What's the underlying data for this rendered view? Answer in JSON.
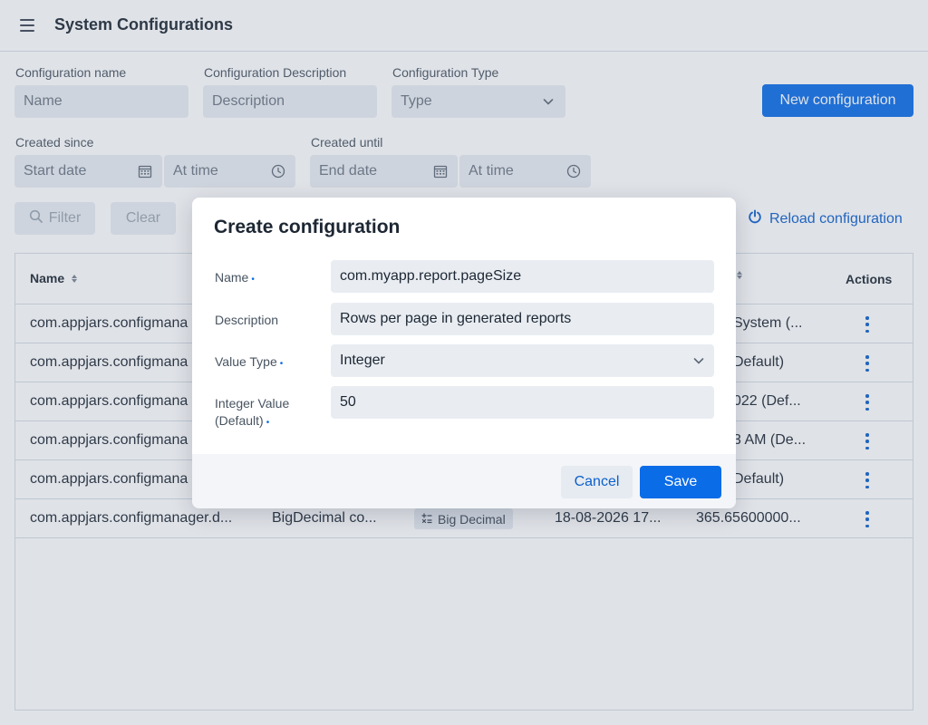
{
  "header": {
    "title": "System Configurations",
    "menu_icon": "hamburger-icon"
  },
  "filters": {
    "name": {
      "label": "Configuration name",
      "placeholder": "Name"
    },
    "description": {
      "label": "Configuration Description",
      "placeholder": "Description"
    },
    "type": {
      "label": "Configuration Type",
      "placeholder": "Type"
    },
    "created_since": {
      "label": "Created since",
      "date_placeholder": "Start date",
      "time_placeholder": "At time"
    },
    "created_until": {
      "label": "Created until",
      "date_placeholder": "End date",
      "time_placeholder": "At time"
    },
    "filter_button": "Filter",
    "clear_button": "Clear"
  },
  "toolbar": {
    "new_configuration": "New configuration",
    "reload_configuration": "Reload configuration"
  },
  "table": {
    "columns": {
      "name": "Name",
      "actions": "Actions"
    },
    "rows": [
      {
        "name": "com.appjars.configmana",
        "value": "System (..."
      },
      {
        "name": "com.appjars.configmana",
        "value": "Default)"
      },
      {
        "name": "com.appjars.configmana",
        "value": "022 (Def..."
      },
      {
        "name": "com.appjars.configmana",
        "value": "3 AM (De..."
      },
      {
        "name": "com.appjars.configmana",
        "value": "Default)"
      },
      {
        "name": "com.appjars.configmanager.d...",
        "description": "BigDecimal co...",
        "type": "Big Decimal",
        "created": "18-08-2026 17...",
        "value": "365.65600000..."
      }
    ]
  },
  "dialog": {
    "title": "Create configuration",
    "fields": {
      "name": {
        "label": "Name",
        "value": "com.myapp.report.pageSize"
      },
      "description": {
        "label": "Description",
        "value": "Rows per page in generated reports"
      },
      "value_type": {
        "label": "Value Type",
        "value": "Integer"
      },
      "integer_value": {
        "label_line1": "Integer Value",
        "label_line2": "(Default)",
        "value": "50"
      }
    },
    "required_marker": "•",
    "cancel": "Cancel",
    "save": "Save"
  },
  "colors": {
    "primary": "#0b6ce8",
    "link": "#0b5fcc",
    "field_bg": "#e9edf2",
    "overlay": "rgba(110,125,145,0.22)"
  }
}
